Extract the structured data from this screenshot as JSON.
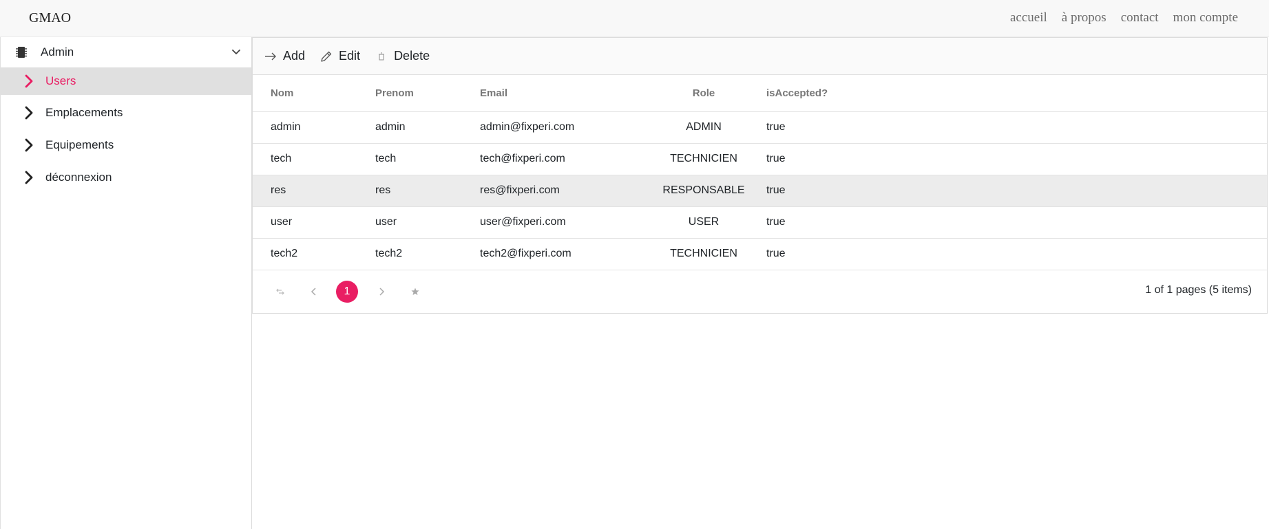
{
  "brand": "GMAO",
  "nav": {
    "accueil": "accueil",
    "a_propos": "à propos",
    "contact": "contact",
    "mon_compte": "mon compte"
  },
  "sidebar": {
    "group_label": "Admin",
    "group_icon": "chip-icon",
    "items": [
      {
        "label": "Users",
        "active": true
      },
      {
        "label": "Emplacements",
        "active": false
      },
      {
        "label": "Equipements",
        "active": false
      },
      {
        "label": "déconnexion",
        "active": false
      }
    ]
  },
  "toolbar": {
    "add_label": "Add",
    "edit_label": "Edit",
    "delete_label": "Delete"
  },
  "table": {
    "columns": [
      "Nom",
      "Prenom",
      "Email",
      "Role",
      "isAccepted?"
    ],
    "rows": [
      [
        "admin",
        "admin",
        "admin@fixperi.com",
        "ADMIN",
        "true"
      ],
      [
        "tech",
        "tech",
        "tech@fixperi.com",
        "TECHNICIEN",
        "true"
      ],
      [
        "res",
        "res",
        "res@fixperi.com",
        "RESPONSABLE",
        "true"
      ],
      [
        "user",
        "user",
        "user@fixperi.com",
        "USER",
        "true"
      ],
      [
        "tech2",
        "tech2",
        "tech2@fixperi.com",
        "TECHNICIEN",
        "true"
      ]
    ],
    "highlighted_row": 2
  },
  "pager": {
    "current_page": "1",
    "info": "1 of 1 pages (5 items)"
  },
  "colors": {
    "accent": "#e91e63",
    "active_bg": "#e0e0e0",
    "highlight_row": "#ececec"
  }
}
